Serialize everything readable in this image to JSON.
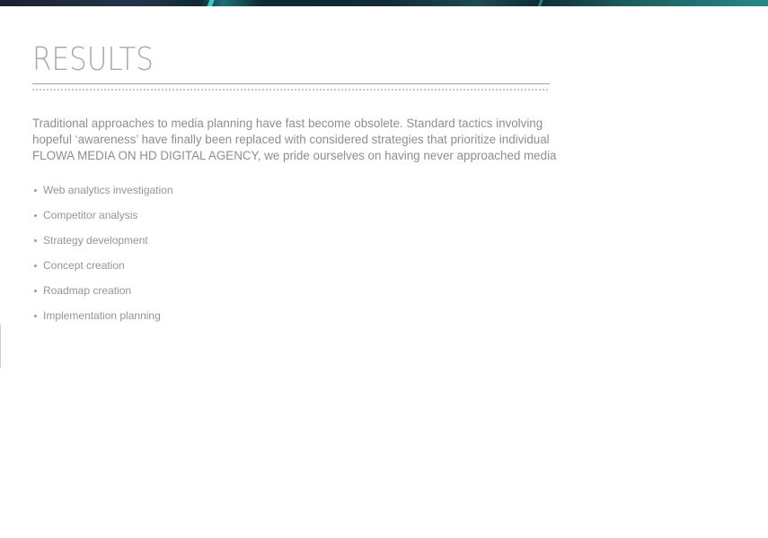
{
  "page": {
    "title": "RESULTS",
    "intro_lines": [
      "Traditional approaches to media planning have fast become obsolete. Standard tactics involving",
      "hopeful ‘awareness’ have finally been replaced with considered strategies that prioritize individual",
      "FLOWA MEDIA ON HD DIGITAL AGENCY, we pride ourselves on having never approached media"
    ],
    "services": [
      "Web analytics investigation",
      "Competitor analysis",
      "Strategy development",
      "Concept creation",
      "Roadmap creation",
      "Implementation planning"
    ]
  },
  "colors": {
    "title": "#a9a9a9",
    "body_text": "#8e8e8e",
    "banner_accent": "#34d6dc"
  }
}
